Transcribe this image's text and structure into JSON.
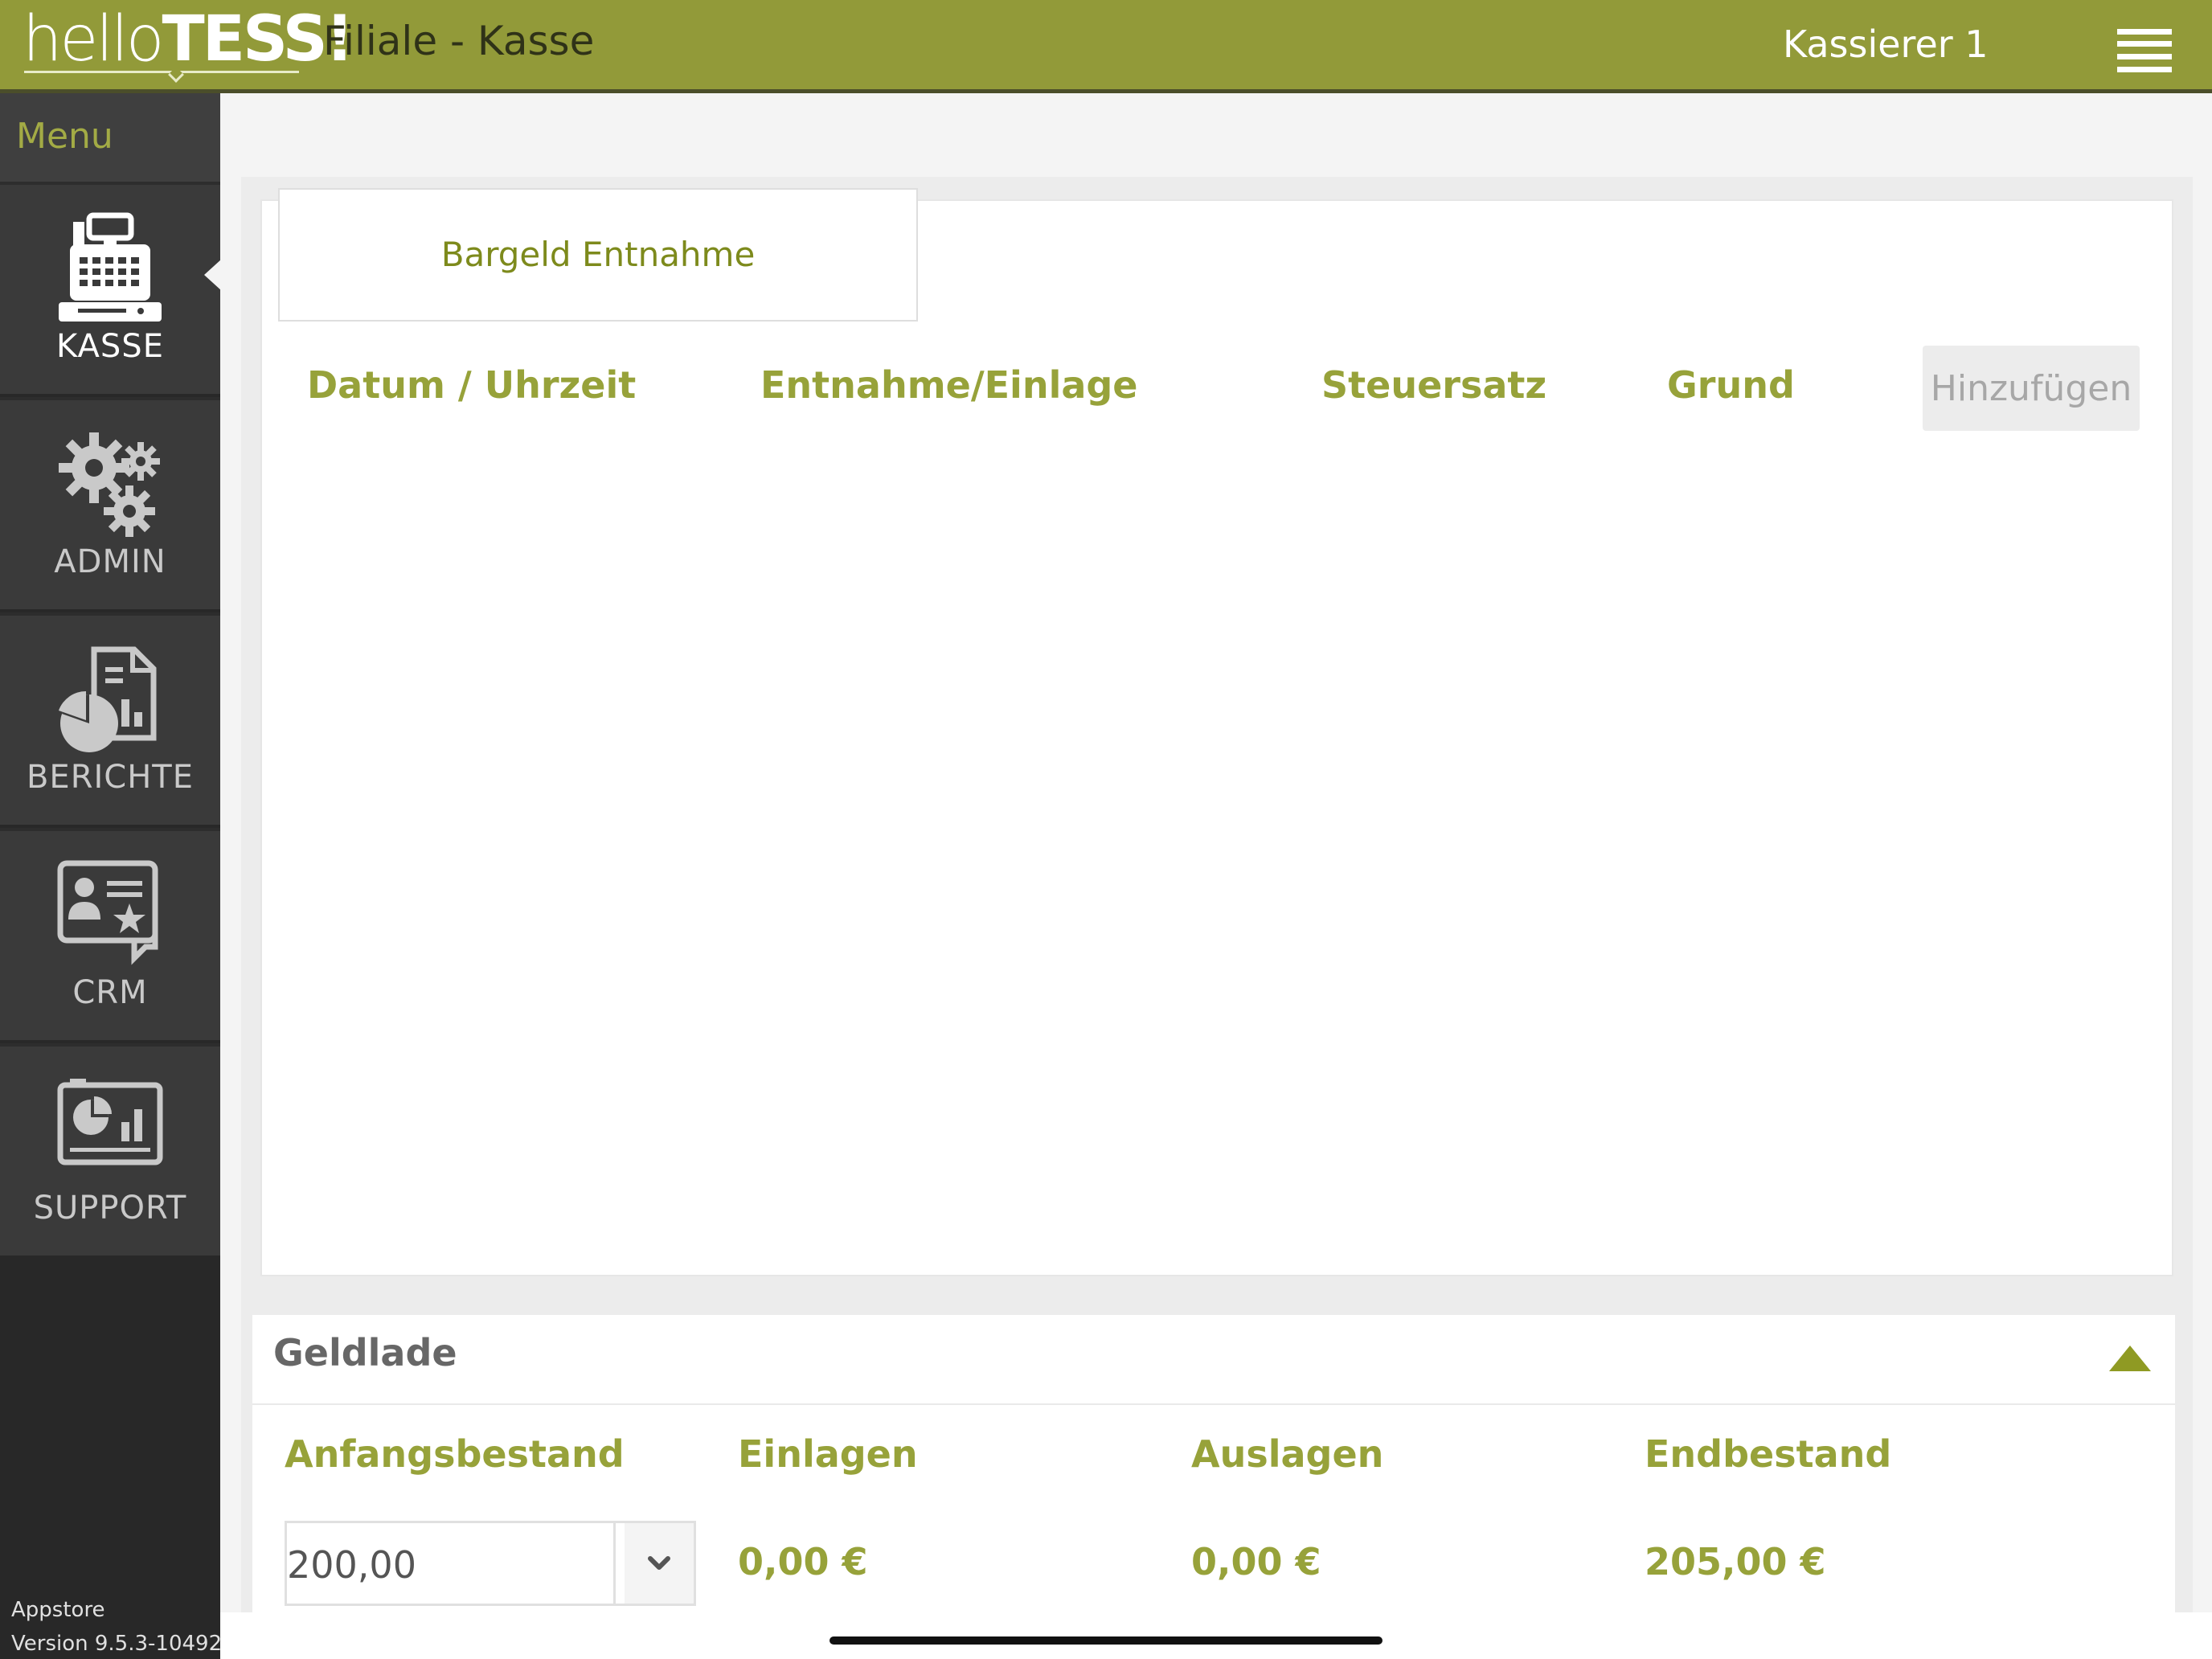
{
  "header": {
    "logo_light": "hello",
    "logo_bold": "TESS!",
    "title": "Filiale - Kasse",
    "user": "Kassierer 1"
  },
  "sidebar": {
    "menu_label": "Menu",
    "items": [
      {
        "label": "KASSE",
        "icon": "cash-register-icon",
        "active": true
      },
      {
        "label": "ADMIN",
        "icon": "gears-icon",
        "active": false
      },
      {
        "label": "BERICHTE",
        "icon": "reports-icon",
        "active": false
      },
      {
        "label": "CRM",
        "icon": "crm-contact-icon",
        "active": false
      },
      {
        "label": "SUPPORT",
        "icon": "support-dashboard-icon",
        "active": false
      }
    ],
    "source": "Appstore",
    "version": "Version 9.5.3-10492"
  },
  "main": {
    "tab_label": "Bargeld Entnahme",
    "columns": [
      "Datum / Uhrzeit",
      "Entnahme/Einlage",
      "Steuersatz",
      "Grund"
    ],
    "add_button": "Hinzufügen"
  },
  "drawer": {
    "title": "Geldlade",
    "labels": [
      "Anfangsbestand",
      "Einlagen",
      "Auslagen",
      "Endbestand"
    ],
    "opening_balance": "200,00",
    "deposits": "0,00 €",
    "withdrawals": "0,00 €",
    "closing_balance": "205,00 €"
  },
  "colors": {
    "header_bg": "#929a39",
    "accent": "#97a23a",
    "sidebar_bg": "#282828"
  }
}
